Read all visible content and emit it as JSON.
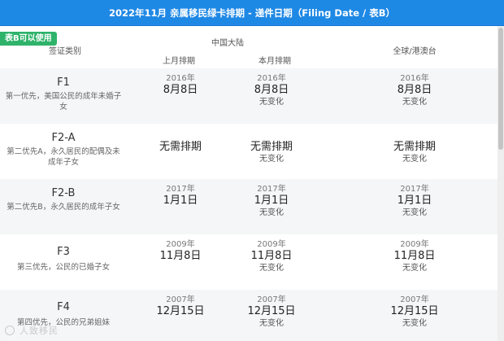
{
  "title": "2022年11月 亲属移民绿卡排期 - 递件日期（Filing Date / 表B）",
  "badge": "表B可以使用",
  "headers": {
    "category": "签证类别",
    "group_china": "中国大陆",
    "prev_schedule": "上月排期",
    "curr_schedule": "本月排期",
    "global": "全球/港澳台"
  },
  "rows": [
    {
      "code": "F1",
      "desc": "第一优先，美国公民的成年未婚子女",
      "prev": {
        "year": "2016年",
        "date": "8月8日"
      },
      "curr": {
        "year": "2016年",
        "date": "8月8日",
        "change": "无变化"
      },
      "global": {
        "year": "2016年",
        "date": "8月8日",
        "change": "无变化"
      }
    },
    {
      "code": "F2-A",
      "desc": "第二优先A，永久居民的配偶及未成年子女",
      "prev": {
        "year": "",
        "date": "无需排期"
      },
      "curr": {
        "year": "",
        "date": "无需排期",
        "change": "无变化"
      },
      "global": {
        "year": "",
        "date": "无需排期",
        "change": "无变化"
      }
    },
    {
      "code": "F2-B",
      "desc": "第二优先B，永久居民的成年子女",
      "prev": {
        "year": "2017年",
        "date": "1月1日"
      },
      "curr": {
        "year": "2017年",
        "date": "1月1日",
        "change": "无变化"
      },
      "global": {
        "year": "2017年",
        "date": "1月1日",
        "change": "无变化"
      }
    },
    {
      "code": "F3",
      "desc": "第三优先，公民的已婚子女",
      "prev": {
        "year": "2009年",
        "date": "11月8日"
      },
      "curr": {
        "year": "2009年",
        "date": "11月8日",
        "change": "无变化"
      },
      "global": {
        "year": "2009年",
        "date": "11月8日",
        "change": "无变化"
      }
    },
    {
      "code": "F4",
      "desc": "第四优先，公民的兄弟姐妹",
      "prev": {
        "year": "2007年",
        "date": "12月15日"
      },
      "curr": {
        "year": "2007年",
        "date": "12月15日",
        "change": "无变化"
      },
      "global": {
        "year": "2007年",
        "date": "12月15日",
        "change": "无变化"
      }
    }
  ],
  "watermark": "人致移民"
}
